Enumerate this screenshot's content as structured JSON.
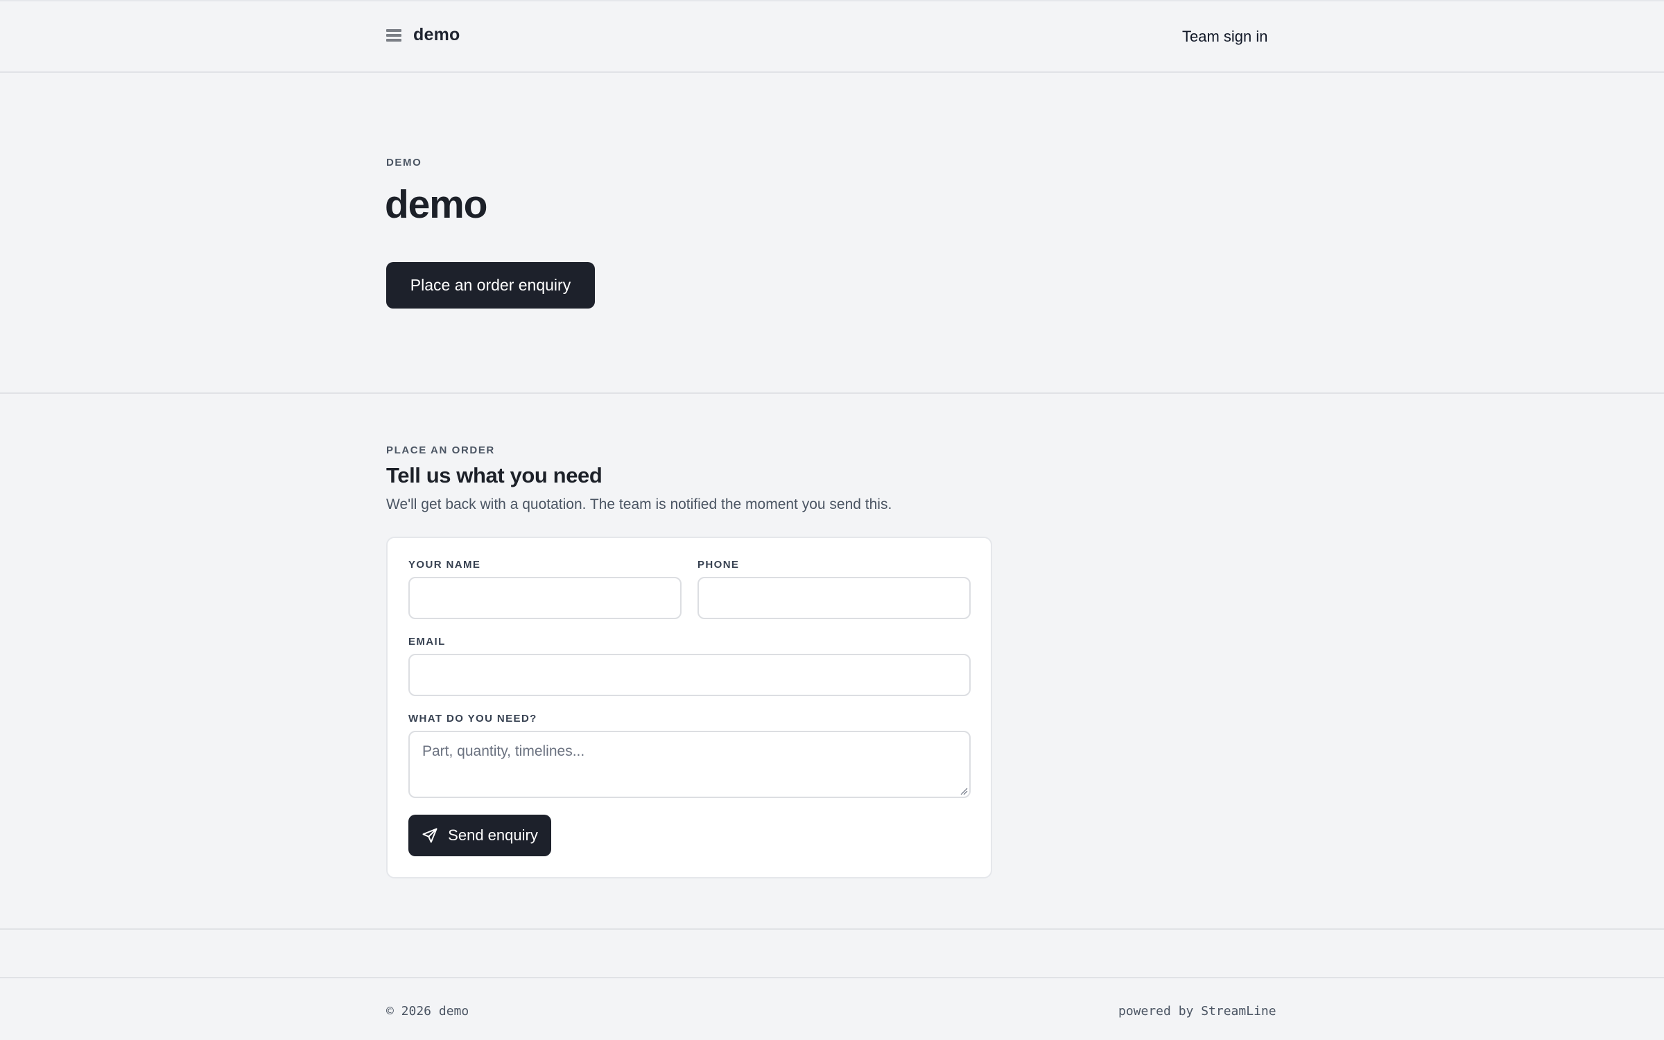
{
  "header": {
    "brand_icon": "menu-lines-icon",
    "brand_name": "demo",
    "sign_in_label": "Team sign in"
  },
  "hero": {
    "eyebrow": "DEMO",
    "title": "demo",
    "cta_label": "Place an order enquiry"
  },
  "order_form": {
    "eyebrow": "PLACE AN ORDER",
    "title": "Tell us what you need",
    "subtitle": "We'll get back with a quotation. The team is notified the moment you send this.",
    "fields": {
      "name": {
        "label": "YOUR NAME",
        "value": "",
        "placeholder": ""
      },
      "phone": {
        "label": "PHONE",
        "value": "",
        "placeholder": ""
      },
      "email": {
        "label": "EMAIL",
        "value": "",
        "placeholder": ""
      },
      "need": {
        "label": "WHAT DO YOU NEED?",
        "value": "",
        "placeholder": "Part, quantity, timelines..."
      }
    },
    "submit_icon": "send-icon",
    "submit_label": "Send enquiry"
  },
  "footer": {
    "copyright": "© 2026 demo",
    "powered_by": "powered by StreamLine"
  },
  "colors": {
    "background": "#f3f4f6",
    "primary_button": "#1d212b",
    "card": "#ffffff",
    "border": "#e0e2e6"
  }
}
